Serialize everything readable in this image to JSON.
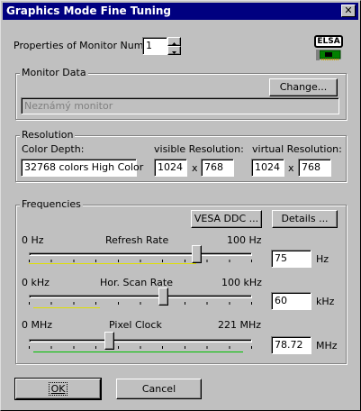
{
  "window": {
    "title": "Graphics Mode Fine Tuning",
    "close_glyph": "✕"
  },
  "monitor_number": {
    "label": "Properties of Monitor Number:",
    "value": "1"
  },
  "logo": {
    "text": "ELSA"
  },
  "monitor_data": {
    "title": "Monitor Data",
    "change_button": "Change...",
    "monitor_name": "Neznámý monitor"
  },
  "resolution": {
    "title": "Resolution",
    "color_depth_label": "Color Depth:",
    "color_depth_value": "32768 colors High Color",
    "visible_label": "visible Resolution:",
    "visible_w": "1024",
    "visible_h": "768",
    "virtual_label": "virtual Resolution:",
    "virtual_w": "1024",
    "virtual_h": "768",
    "times": "x"
  },
  "frequencies": {
    "title": "Frequencies",
    "vesa_button": "VESA DDC ...",
    "details_button": "Details ...",
    "refresh": {
      "min": "0 Hz",
      "label": "Refresh Rate",
      "max": "100 Hz",
      "value": "75",
      "unit": "Hz",
      "level": 0.75,
      "range": [
        0,
        0.75
      ],
      "range_color": "#e0e000"
    },
    "hscan": {
      "min": "0 kHz",
      "label": "Hor. Scan Rate",
      "max": "100 kHz",
      "value": "60",
      "unit": "kHz",
      "level": 0.6,
      "range": [
        0.02,
        0.32
      ],
      "range_color": "#e0e000"
    },
    "pixel": {
      "min": "0 MHz",
      "label": "Pixel Clock",
      "max": "221 MHz",
      "value": "78.72",
      "unit": "MHz",
      "level": 0.36,
      "range": [
        0.02,
        0.96
      ],
      "range_color": "#00c000"
    }
  },
  "buttons": {
    "ok": "OK",
    "cancel": "Cancel"
  }
}
